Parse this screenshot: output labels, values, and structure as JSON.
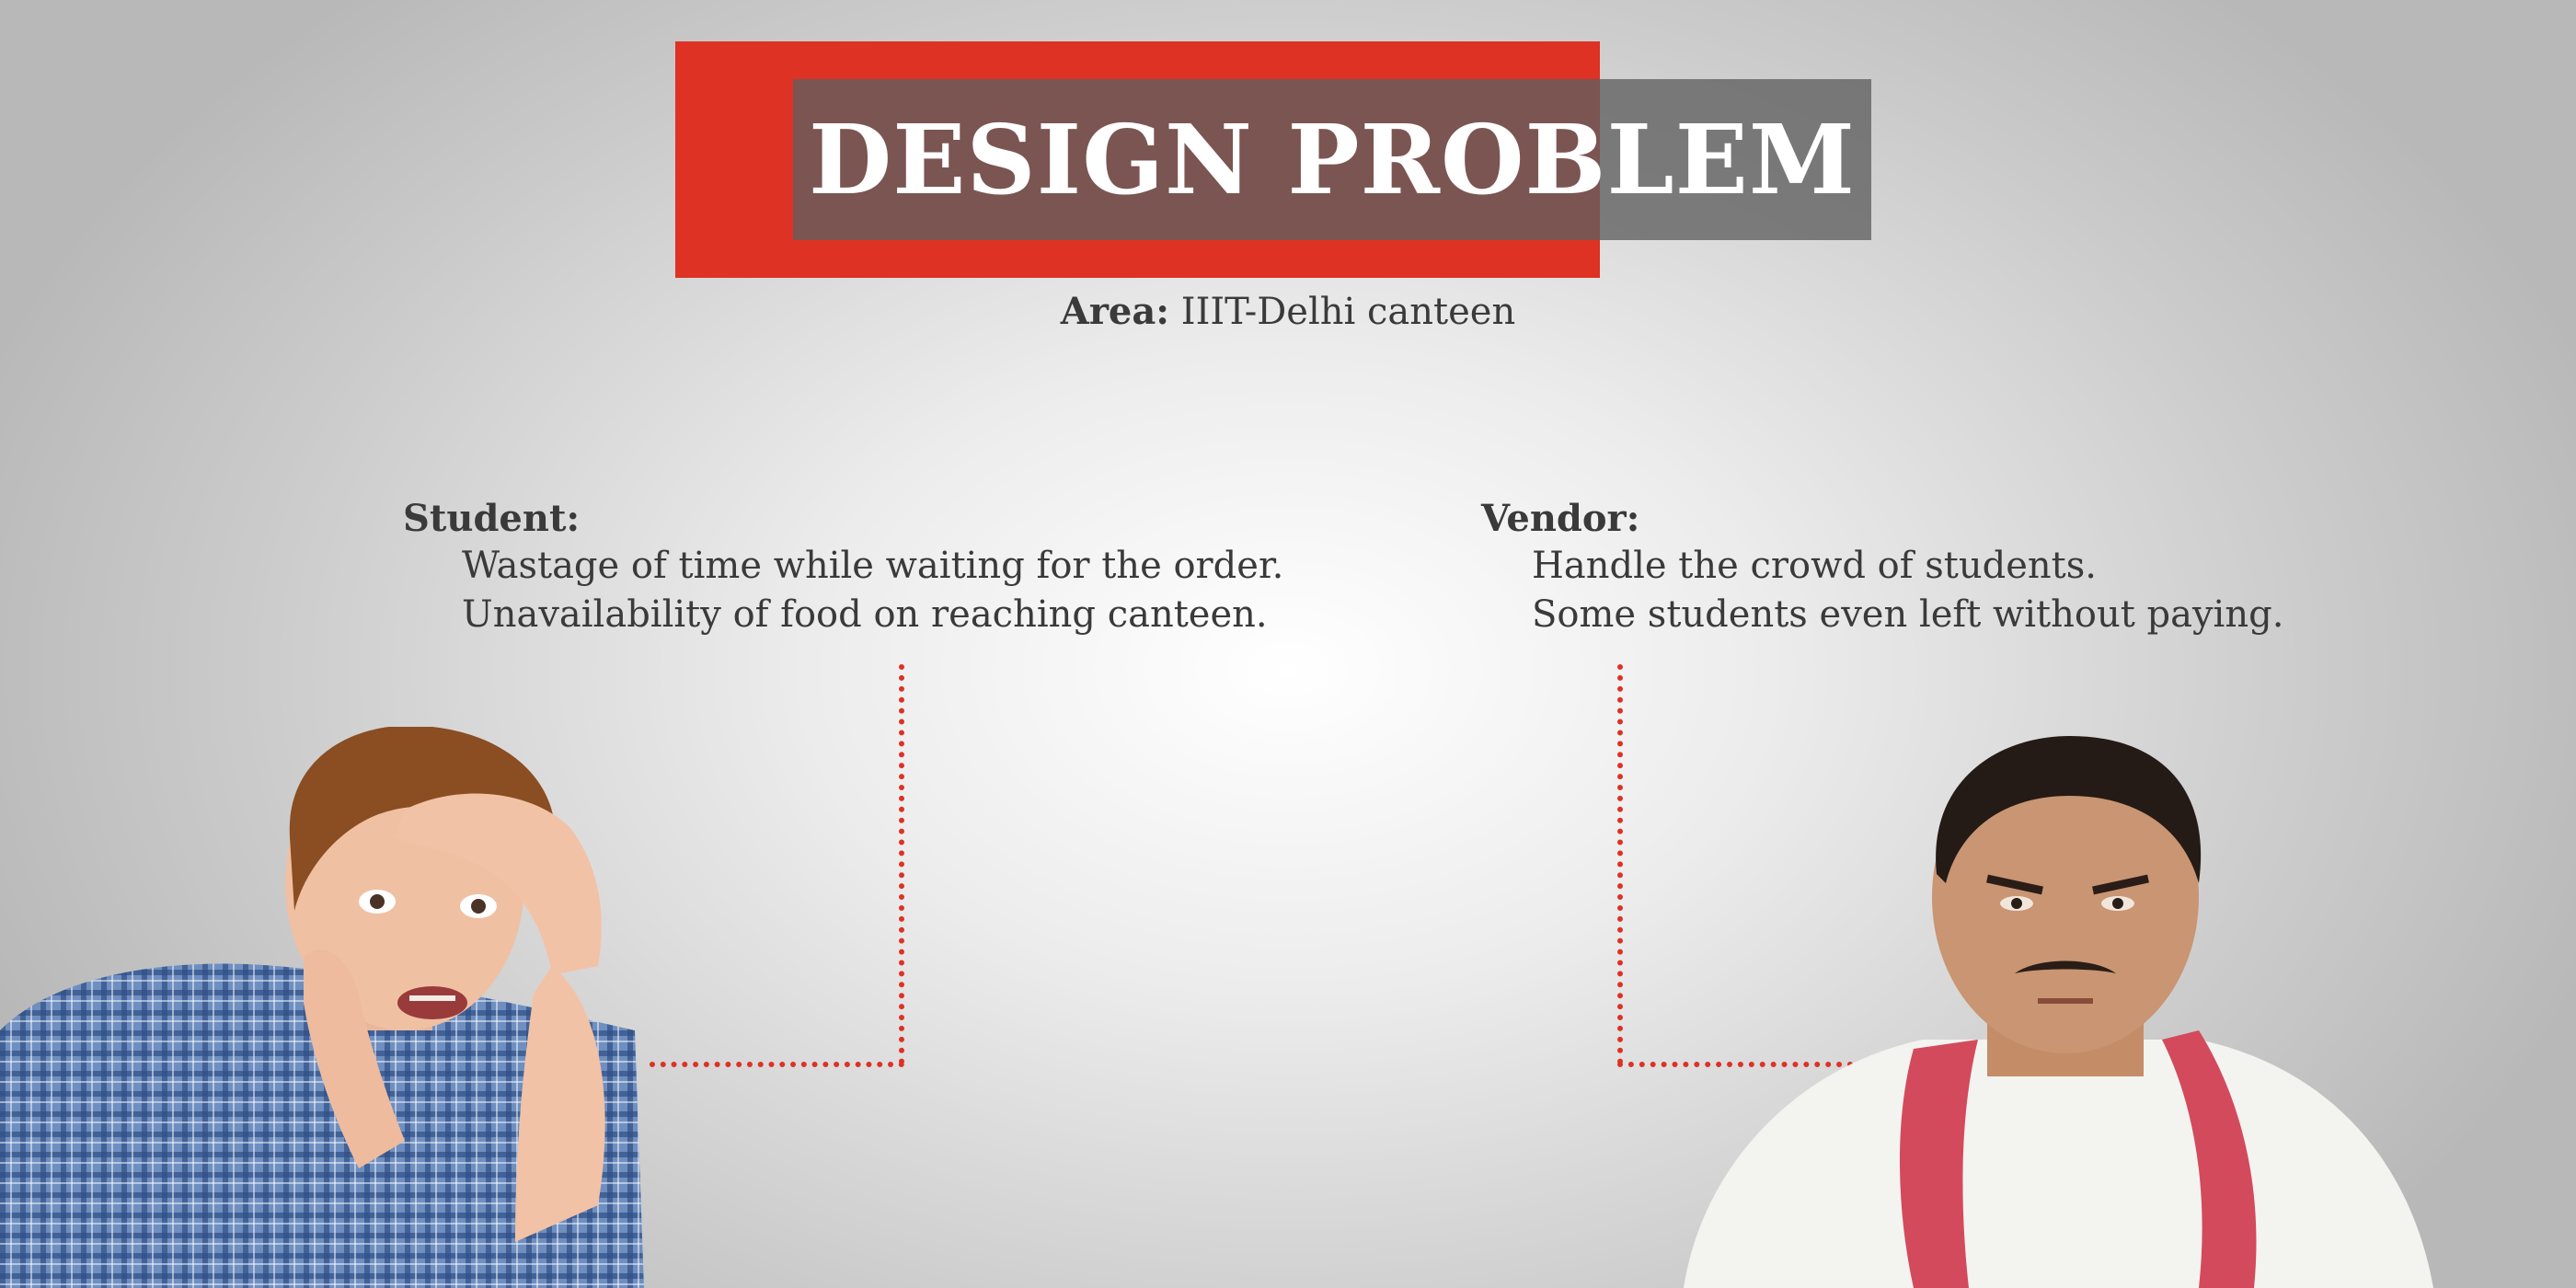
{
  "title": "DESIGN PROBLEM",
  "area": {
    "label": "Area:",
    "value": "IIIT-Delhi canteen"
  },
  "student": {
    "heading": "Student:",
    "points": [
      "Wastage of time while waiting for the order.",
      "Unavailability of food on reaching canteen."
    ]
  },
  "vendor": {
    "heading": "Vendor:",
    "points": [
      "Handle the crowd of students.",
      "Some students even left without paying."
    ]
  },
  "colors": {
    "accent_red": "#dd3224",
    "title_gray": "#5f5f5f",
    "text": "#3a3a3a",
    "background_center": "#ffffff",
    "background_edge": "#b8b8b8"
  },
  "images": [
    "stressed-student-photo",
    "frowning-vendor-photo"
  ]
}
